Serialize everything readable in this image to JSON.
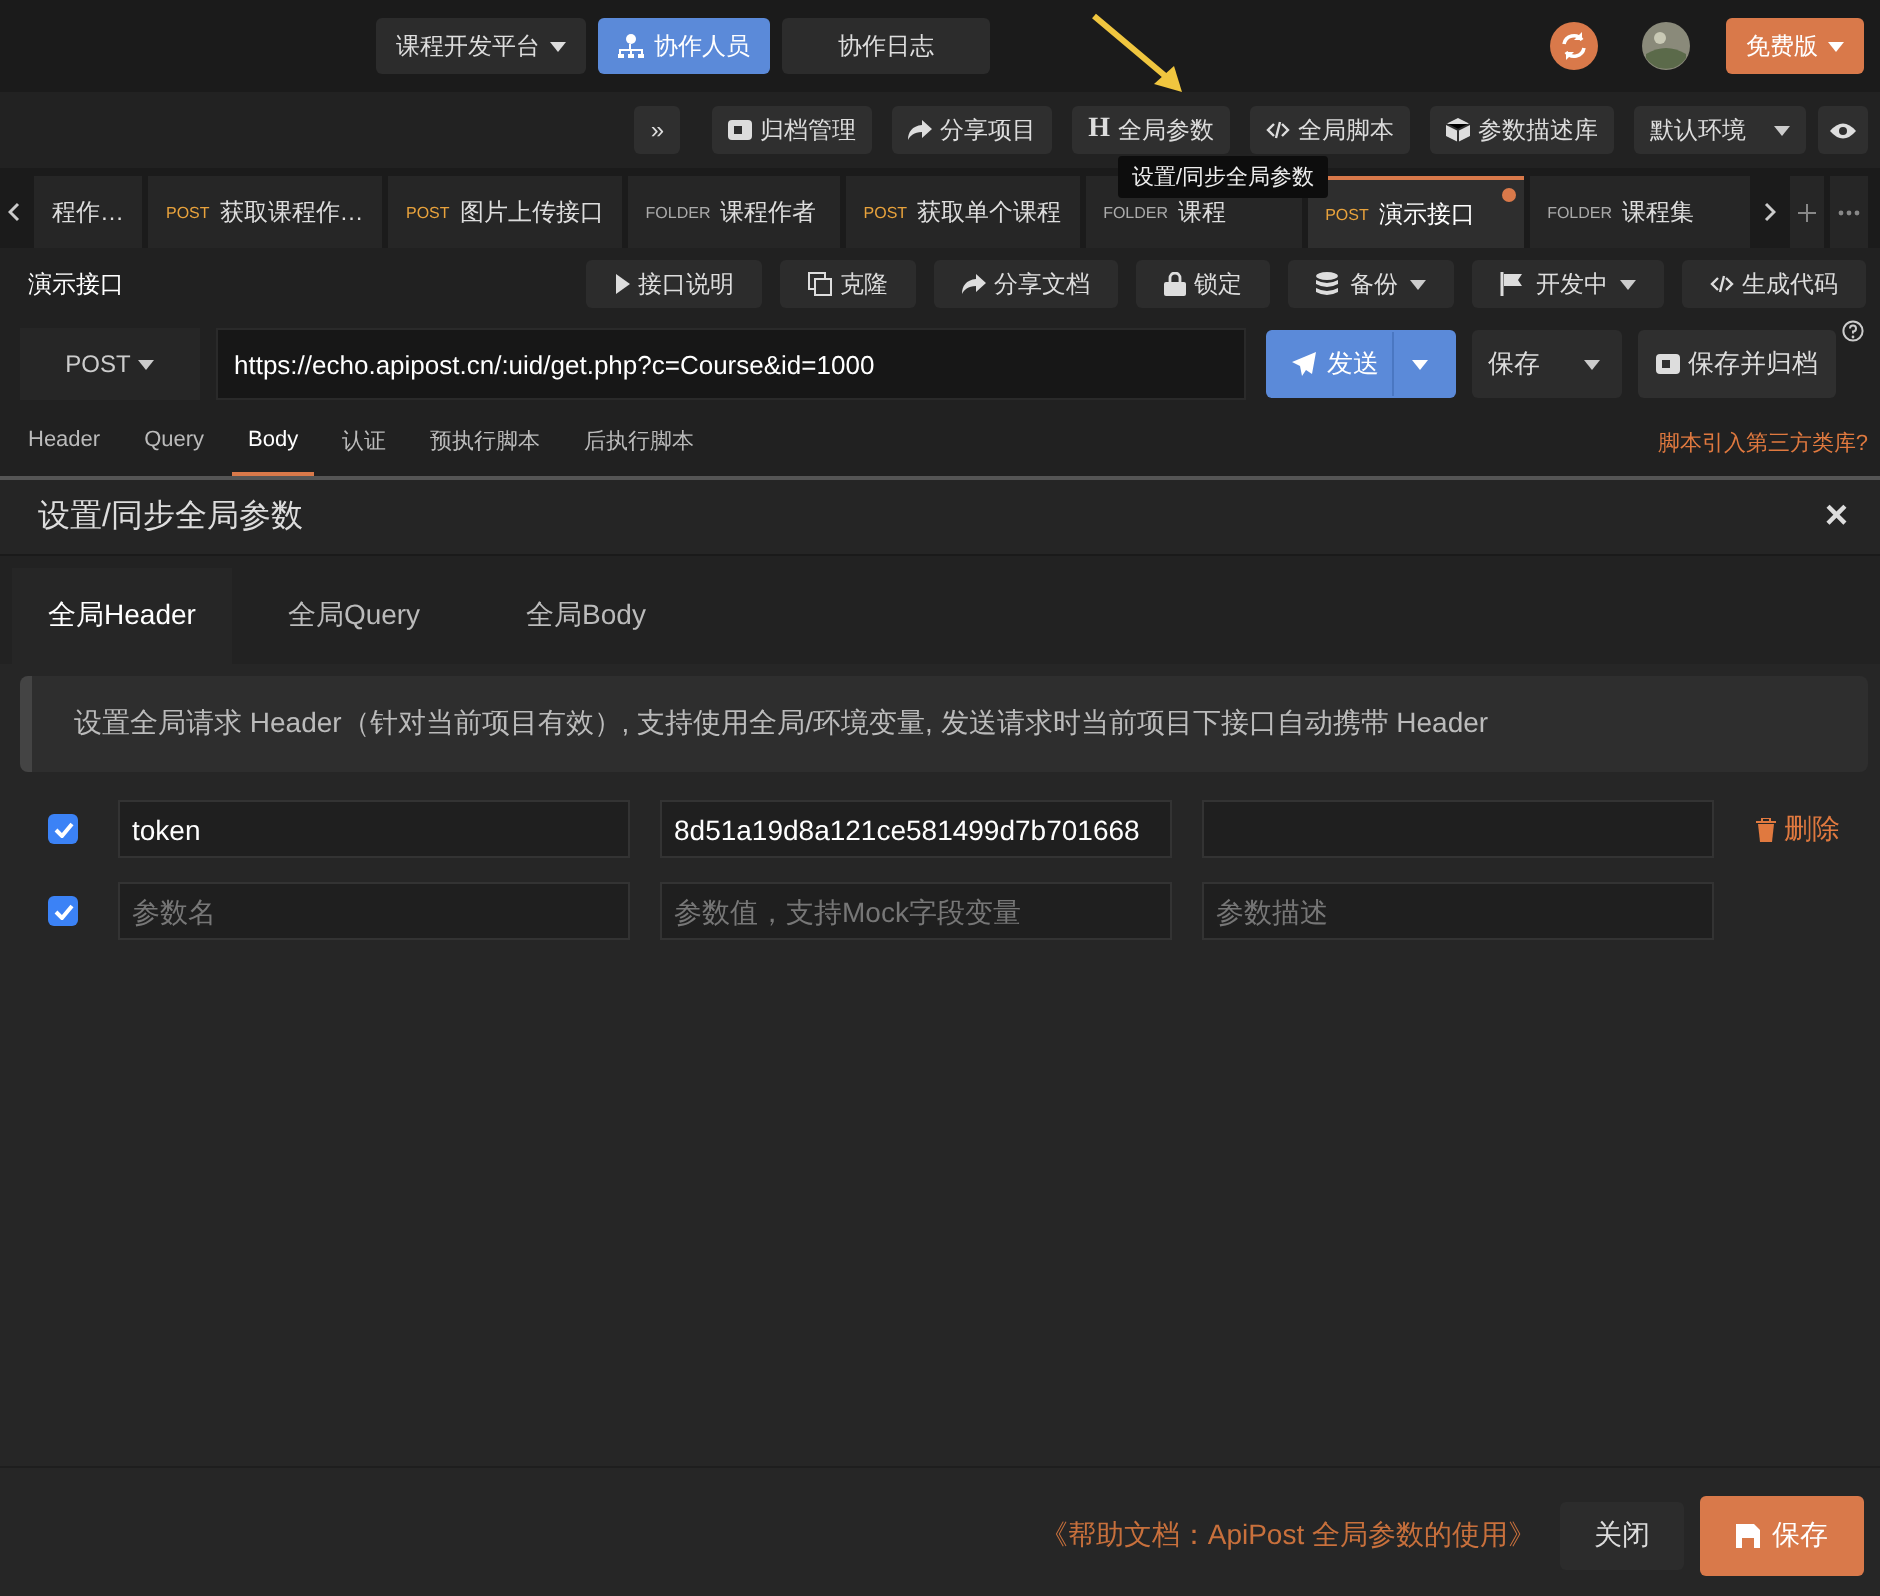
{
  "topbar": {
    "project_menu": "课程开发平台",
    "members_button": "协作人员",
    "log_button": "协作日志",
    "plan_button": "免费版"
  },
  "toolbar": {
    "expand": "»",
    "buttons": [
      {
        "label": "归档管理"
      },
      {
        "label": "分享项目"
      },
      {
        "glyph": "H",
        "label": "全局参数"
      },
      {
        "label": "全局脚本"
      },
      {
        "label": "参数描述库"
      }
    ],
    "environment": "默认环境",
    "tooltip": "设置/同步全局参数"
  },
  "tabs": [
    {
      "name": "程作…",
      "selected": false,
      "modified": false
    },
    {
      "method": "POST",
      "name": "获取课程作…",
      "selected": false,
      "modified": false
    },
    {
      "method": "POST",
      "name": "图片上传接口",
      "selected": false,
      "modified": false
    },
    {
      "method": "FOLDER",
      "name": "课程作者",
      "selected": false,
      "modified": false
    },
    {
      "method": "POST",
      "name": "获取单个课程",
      "selected": false,
      "modified": false
    },
    {
      "method": "FOLDER",
      "name": "课程",
      "selected": false,
      "modified": false
    },
    {
      "method": "POST",
      "name": "演示接口",
      "selected": true,
      "modified": true
    },
    {
      "method": "FOLDER",
      "name": "课程集",
      "selected": false,
      "modified": false
    }
  ],
  "request": {
    "name": "演示接口",
    "actions": [
      {
        "label": "接口说明",
        "dropdown": false
      },
      {
        "label": "克隆",
        "dropdown": false
      },
      {
        "label": "分享文档",
        "dropdown": false
      },
      {
        "label": "锁定",
        "dropdown": false
      },
      {
        "label": "备份",
        "dropdown": true
      },
      {
        "label": "开发中",
        "dropdown": true
      },
      {
        "label": "生成代码",
        "dropdown": false
      }
    ],
    "method": "POST",
    "url": "https://echo.apipost.cn/:uid/get.php?c=Course&id=1000",
    "send_button": "发送",
    "save_button": "保存",
    "save_archive_button": "保存并归档",
    "sections": [
      {
        "label": "Header",
        "selected": false
      },
      {
        "label": "Query",
        "selected": false
      },
      {
        "label": "Body",
        "selected": true
      },
      {
        "label": "认证",
        "selected": false
      },
      {
        "label": "预执行脚本",
        "selected": false
      },
      {
        "label": "后执行脚本",
        "selected": false
      }
    ],
    "script_link": "脚本引入第三方类库?"
  },
  "modal": {
    "title": "设置/同步全局参数",
    "close": "×",
    "tabs": [
      {
        "label": "全局Header",
        "selected": true
      },
      {
        "label": "全局Query",
        "selected": false
      },
      {
        "label": "全局Body",
        "selected": false
      }
    ],
    "notice": "设置全局请求 Header（针对当前项目有效）, 支持使用全局/环境变量, 发送请求时当前项目下接口自动携带 Header",
    "params": [
      {
        "checked": true,
        "key": {
          "value": "token"
        },
        "value": {
          "value": "8d51a19d8a121ce581499d7b701668"
        },
        "deletable": true
      },
      {
        "checked": true,
        "key": {
          "placeholder": "参数名"
        },
        "value": {
          "placeholder": "参数值，支持Mock字段变量"
        },
        "description": {
          "placeholder": "参数描述"
        },
        "deletable": false
      }
    ],
    "delete_label": "删除",
    "help_link": "《帮助文档：ApiPost 全局参数的使用》",
    "close_button": "关闭",
    "save_button": "保存"
  }
}
